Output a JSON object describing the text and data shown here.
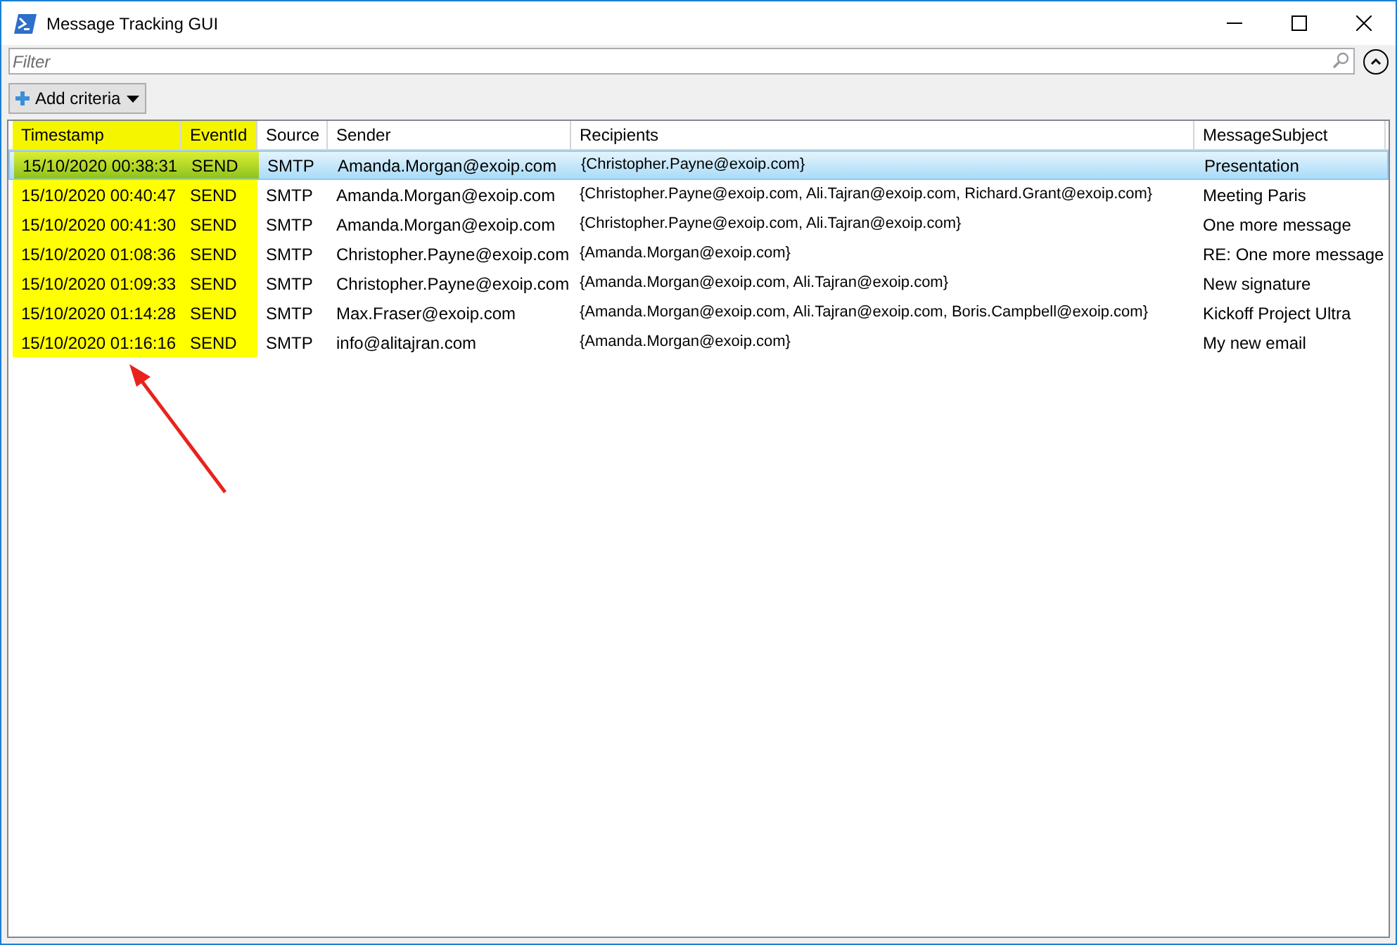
{
  "window": {
    "title": "Message Tracking GUI"
  },
  "filter": {
    "placeholder": "Filter"
  },
  "add_criteria_button": {
    "label": "Add criteria"
  },
  "table": {
    "columns": [
      {
        "label": "Timestamp",
        "highlighted": true
      },
      {
        "label": "EventId",
        "highlighted": true
      },
      {
        "label": "Source",
        "highlighted": false
      },
      {
        "label": "Sender",
        "highlighted": false
      },
      {
        "label": "Recipients",
        "highlighted": false
      },
      {
        "label": "MessageSubject",
        "highlighted": false
      }
    ],
    "rows": [
      {
        "selected": true,
        "cells": [
          "15/10/2020 00:38:31",
          "SEND",
          "SMTP",
          "Amanda.Morgan@exoip.com",
          "{Christopher.Payne@exoip.com}",
          "Presentation"
        ]
      },
      {
        "selected": false,
        "cells": [
          "15/10/2020 00:40:47",
          "SEND",
          "SMTP",
          "Amanda.Morgan@exoip.com",
          "{Christopher.Payne@exoip.com, Ali.Tajran@exoip.com, Richard.Grant@exoip.com}",
          "Meeting Paris"
        ]
      },
      {
        "selected": false,
        "cells": [
          "15/10/2020 00:41:30",
          "SEND",
          "SMTP",
          "Amanda.Morgan@exoip.com",
          "{Christopher.Payne@exoip.com, Ali.Tajran@exoip.com}",
          "One more message"
        ]
      },
      {
        "selected": false,
        "cells": [
          "15/10/2020 01:08:36",
          "SEND",
          "SMTP",
          "Christopher.Payne@exoip.com",
          "{Amanda.Morgan@exoip.com}",
          "RE: One more message"
        ]
      },
      {
        "selected": false,
        "cells": [
          "15/10/2020 01:09:33",
          "SEND",
          "SMTP",
          "Christopher.Payne@exoip.com",
          "{Amanda.Morgan@exoip.com, Ali.Tajran@exoip.com}",
          "New signature"
        ]
      },
      {
        "selected": false,
        "cells": [
          "15/10/2020 01:14:28",
          "SEND",
          "SMTP",
          "Max.Fraser@exoip.com",
          "{Amanda.Morgan@exoip.com, Ali.Tajran@exoip.com, Boris.Campbell@exoip.com}",
          "Kickoff Project Ultra"
        ]
      },
      {
        "selected": false,
        "cells": [
          "15/10/2020 01:16:16",
          "SEND",
          "SMTP",
          "info@alitajran.com",
          "{Amanda.Morgan@exoip.com}",
          "My new email"
        ]
      }
    ]
  }
}
